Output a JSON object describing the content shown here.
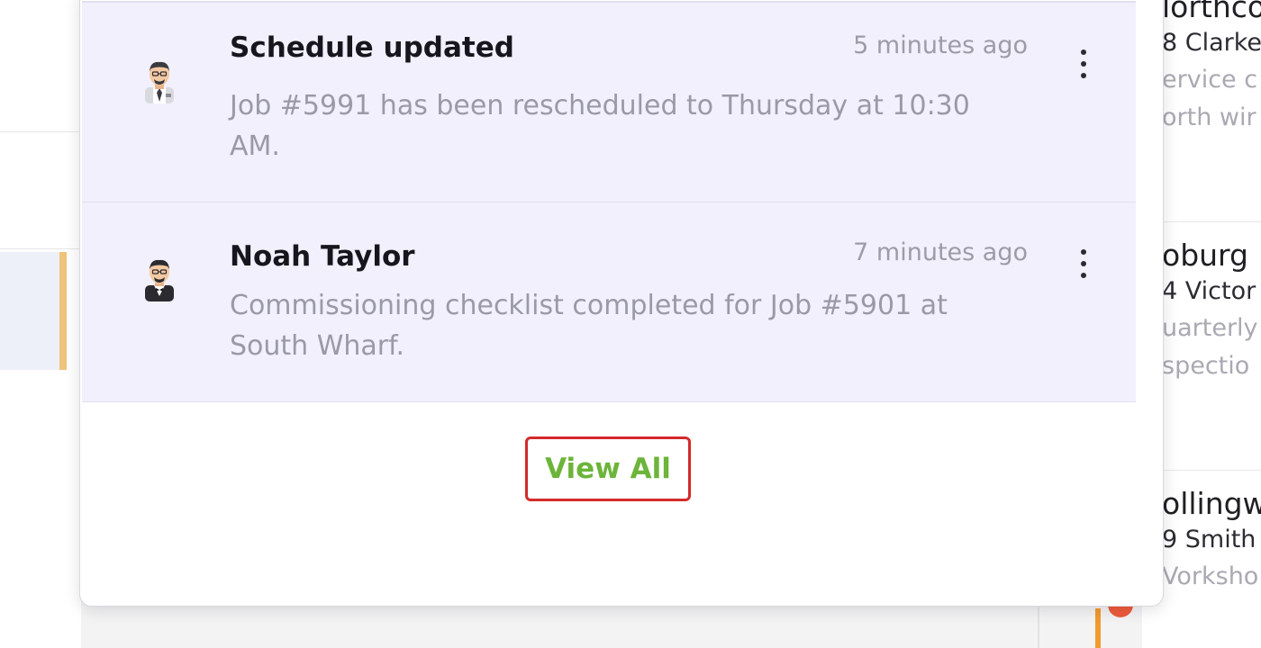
{
  "notifications": [
    {
      "title": "Schedule updated",
      "time": "5 minutes ago",
      "body": "Job #5991 has been rescheduled to Thursday at 10:30 AM."
    },
    {
      "title": "Noah Taylor",
      "time": "7 minutes ago",
      "body": "Commissioning checklist completed for Job #5901 at South Wharf."
    }
  ],
  "view_all_label": "View All",
  "background_locations": [
    {
      "name": "lorthco",
      "address": "8 Clarke",
      "desc1": "ervice c",
      "desc2": "orth wir"
    },
    {
      "name": "oburg",
      "address": "4 Victor",
      "desc1": "uarterly",
      "desc2": "spectio"
    },
    {
      "name": "ollingw",
      "address": "9 Smith",
      "desc1": "Vorksho",
      "desc2": ""
    }
  ],
  "colors": {
    "unread_bg": "#f2f0fd",
    "view_all_text": "#6cb43a",
    "highlight_border": "#d42a2a",
    "accent_orange": "#f29a2e"
  },
  "icons": {
    "avatar": "man-avatar-icon",
    "menu": "more-vertical-icon"
  }
}
